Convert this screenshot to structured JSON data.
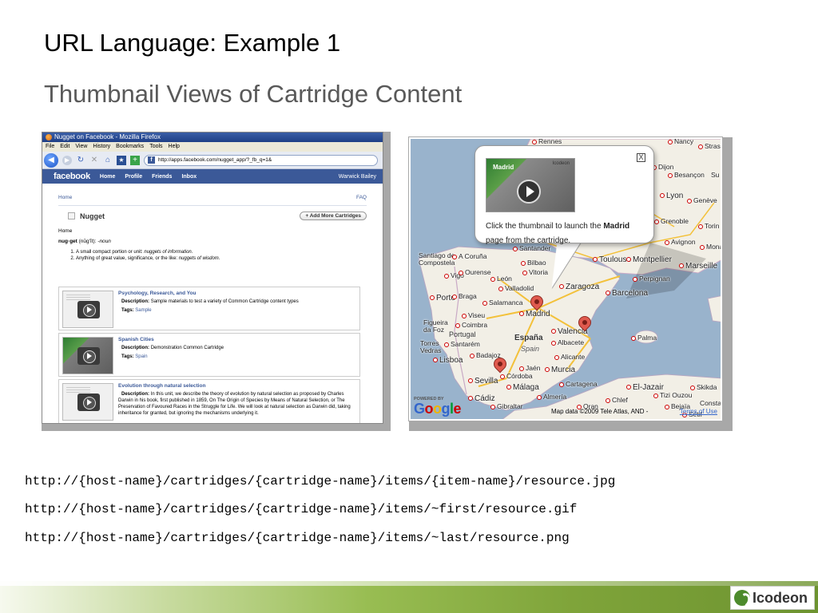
{
  "slide": {
    "title": "URL Language: Example 1",
    "subtitle": "Thumbnail Views of Cartridge Content"
  },
  "browser": {
    "window_title": "Nugget on Facebook - Mozilla Firefox",
    "menu": [
      "File",
      "Edit",
      "View",
      "History",
      "Bookmarks",
      "Tools",
      "Help"
    ],
    "url": "http://apps.facebook.com/nugget_app/?_fb_q=1&",
    "fb_logo": "facebook",
    "fb_nav": [
      "Home",
      "Profile",
      "Friends",
      "Inbox"
    ],
    "fb_user": "Warwick Bailey"
  },
  "facebook_app": {
    "home_link": "Home",
    "faq_link": "FAQ",
    "app_name": "Nugget",
    "add_button": "+ Add More Cartridges",
    "breadcrumb": "Home",
    "definition_word": "nug·get",
    "definition_pron": " (nŭg'ĭt): ",
    "definition_pos": "-noun",
    "def_1_prefix": "A small compact portion or unit: ",
    "def_1_example": "nuggets of information.",
    "def_2_prefix": "Anything of great value, significance, or the like: ",
    "def_2_example": "nuggets of wisdom.",
    "description_label": "Description:",
    "tags_label": "Tags:",
    "cartridges": [
      {
        "title": "Psychology, Research, and You",
        "description": "Sample materials to test a variety of Common Cartridge content types",
        "tags": "Sample"
      },
      {
        "title": "Spanish Cities",
        "description": "Demonstration Common Cartridge",
        "tags": "Spain"
      },
      {
        "title": "Evolution through natural selection",
        "description": "In this unit, we describe the theory of evolution by natural selection as proposed by Charles Darwin in his book, first published in 1859, On The Origin of Species by Means of Natural Selection, or The Preservation of Favoured Races in the Struggle for Life. We will look at natural selection as Darwin did, taking inheritance for granted, but ignoring the mechanisms underlying it."
      }
    ]
  },
  "map": {
    "bubble_brand": "Icodeon",
    "bubble_thumb_word": "Madrid",
    "bubble_text_before": "Click the thumbnail to launch the ",
    "bubble_text_bold": "Madrid",
    "bubble_text_after": " page from the cartridge.",
    "close_glyph": "X",
    "powered_by": "POWERED BY",
    "google": "Google",
    "attribution": "Map data ©2009 Tele Atlas, AND -",
    "terms": "Terms of Use",
    "cities": {
      "rennes": "Rennes",
      "nancy": "Nancy",
      "strasbourg": "Strasb",
      "dijon": "Dijon",
      "besancon": "Besançon",
      "su": "Su",
      "lyon": "Lyon",
      "geneve": "Genève",
      "grenoble": "Grenoble",
      "torino": "Torin",
      "toulouse": "Toulouse",
      "montpellier": "Montpellier",
      "marseille": "Marseille",
      "monaco": "Monac",
      "avignon": "Avignon",
      "perpignan": "Perpignan",
      "santander": "Santander",
      "bilbao": "Bilbao",
      "vitoria": "Vitoria",
      "leon": "León",
      "santiago": "Santiago de Compostela",
      "acoruna": "A Coruña",
      "vigo": "Vigo",
      "ourense": "Ourense",
      "valladolid": "Valladolid",
      "zaragoza": "Zaragoza",
      "barcelona": "Barcelona",
      "porto": "Porto",
      "braga": "Braga",
      "salamanca": "Salamanca",
      "madrid": "Madrid",
      "valencia": "Valencia",
      "palma": "Palma",
      "viseu": "Viseu",
      "coimbra": "Coimbra",
      "figueira": "Figueira da Foz",
      "santarem": "Santarém",
      "torres": "Torres Vedras",
      "lisboa": "Lisboa",
      "badajoz": "Badajoz",
      "albacete": "Albacete",
      "alicante": "Alicante",
      "jaen": "Jaén",
      "murcia": "Murcia",
      "cordoba": "Córdoba",
      "sevilla": "Sevilla",
      "malaga": "Málaga",
      "cartagena": "Cartagena",
      "almeria": "Almería",
      "cadiz": "Cádiz",
      "gibraltar": "Gibraltar",
      "eljazair": "El-Jazair",
      "tiziouzou": "Tizi Ouzou",
      "skikda": "Skikda",
      "constantine": "Consta",
      "chlef": "Chlef",
      "oran": "Oran",
      "setif": "Sétif",
      "bejaia": "Bejaïa"
    },
    "countries": {
      "espana": "España",
      "portugal": "Portugal"
    },
    "regions": {
      "spain": "Spain"
    }
  },
  "urls": [
    "http://{host-name}/cartridges/{cartridge-name}/items/{item-name}/resource.jpg",
    "http://{host-name}/cartridges/{cartridge-name}/items/~first/resource.gif",
    "http://{host-name}/cartridges/{cartridge-name}/items/~last/resource.png"
  ],
  "footer": {
    "brand": "Icodeon"
  },
  "colors": {
    "facebook_blue": "#3b5998",
    "map_sea": "#99b3cc",
    "map_land": "#f2efe6",
    "marker_red": "#e05a4e",
    "footer_green": "#7fa43a"
  }
}
